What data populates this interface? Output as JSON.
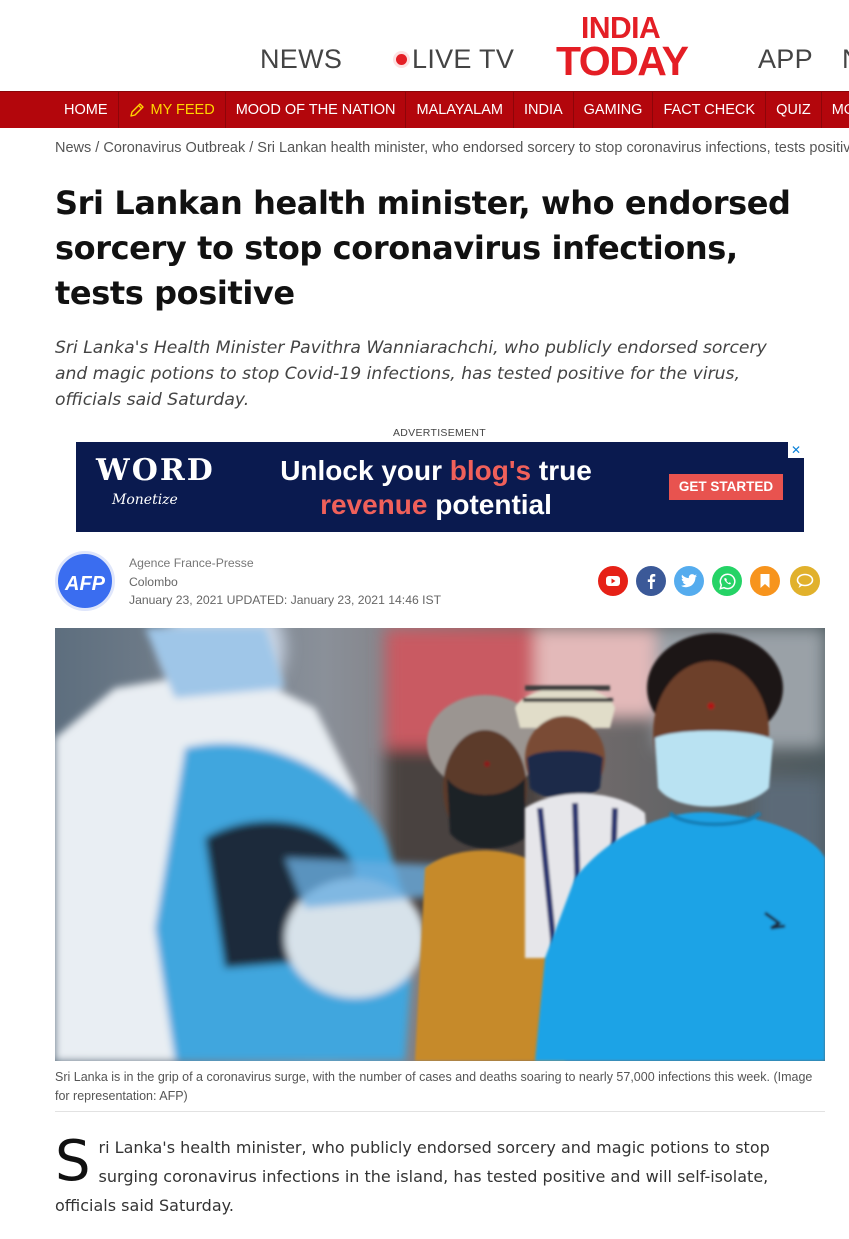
{
  "header": {
    "links": {
      "news": "NEWS",
      "live_tv": "LIVE TV",
      "app": "APP",
      "more": "N"
    },
    "logo": {
      "line1": "INDIA",
      "line2": "TODAY"
    }
  },
  "nav": {
    "items": [
      "HOME",
      "MY FEED",
      "MOOD OF THE NATION",
      "MALAYALAM",
      "INDIA",
      "GAMING",
      "FACT CHECK",
      "QUIZ",
      "MOVIES"
    ]
  },
  "breadcrumb": {
    "items": [
      "News",
      "Coronavirus Outbreak",
      "Sri Lankan health minister, who endorsed sorcery to stop coronavirus infections, tests positive"
    ],
    "separator": " / "
  },
  "article": {
    "headline": "Sri Lankan health minister, who endorsed sorcery to stop coronavirus infections, tests positive",
    "summary": "Sri Lanka's Health Minister Pavithra Wanniarachchi, who publicly endorsed sorcery and magic potions to stop Covid-19 infections, has tested positive for the virus, officials said Saturday.",
    "author": "Agence France-Presse",
    "location": "Colombo",
    "date_line": "January 23, 2021  UPDATED: January 23, 2021 14:46 IST",
    "avatar_text": "AFP",
    "caption": "Sri Lanka is in the grip of a coronavirus surge, with the number of cases and deaths soaring to nearly 57,000 infections this week. (Image for representation: AFP)",
    "dropcap": "S",
    "body_first": "ri Lanka's health minister, who publicly endorsed sorcery and magic potions to stop surging coronavirus infections in the island, has tested positive and will self-isolate, officials said Saturday."
  },
  "ad": {
    "label": "ADVERTISEMENT",
    "logo_word": "WORD",
    "logo_sub": "Monetize",
    "text_part1": "Unlock your ",
    "text_accent1": "blog's",
    "text_part2": " true ",
    "text_accent2": "revenue",
    "text_part3": " potential",
    "cta": "GET STARTED",
    "close": "✕"
  },
  "share_icons": [
    {
      "name": "youtube-icon",
      "color": "#e62117"
    },
    {
      "name": "facebook-icon",
      "color": "#3b5998"
    },
    {
      "name": "twitter-icon",
      "color": "#55acee"
    },
    {
      "name": "whatsapp-icon",
      "color": "#25d366"
    },
    {
      "name": "bookmark-icon",
      "color": "#f7941d"
    },
    {
      "name": "comment-icon",
      "color": "#e1b12c"
    }
  ],
  "colors": {
    "brand_red": "#e41e25",
    "nav_red": "#b3060c",
    "feed_yellow": "#ffd600",
    "ad_bg": "#0a1a4f",
    "ad_accent": "#f0605a"
  }
}
